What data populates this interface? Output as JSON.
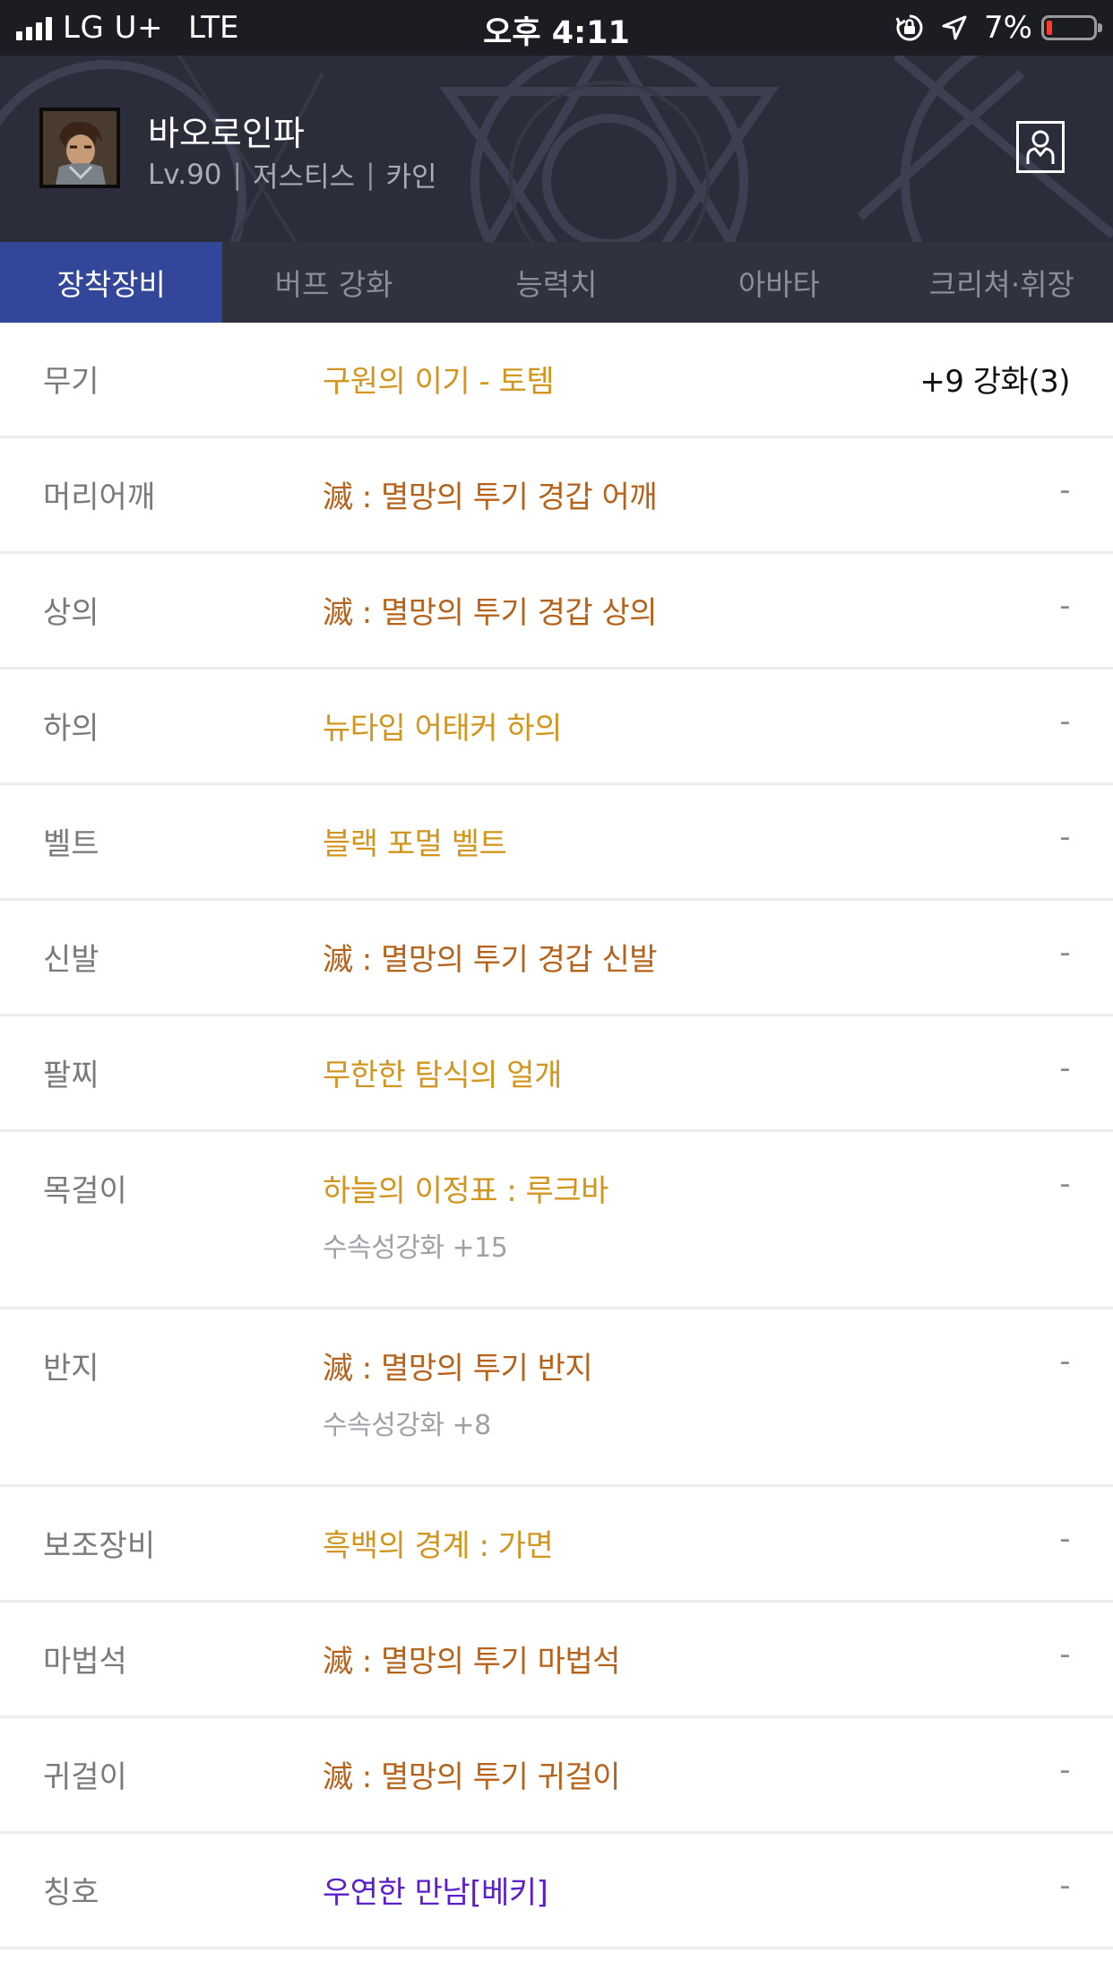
{
  "status_bar": {
    "carrier": "LG U+",
    "network": "LTE",
    "time": "오후 4:11",
    "battery_percent": "7%",
    "battery_level": 0.07,
    "battery_color": "#ff3b30"
  },
  "character": {
    "name": "바오로인파",
    "level": "Lv.90",
    "job": "저스티스",
    "server": "카인",
    "separator": "|",
    "avatar_icon": "character-portrait"
  },
  "tabs": [
    {
      "label": "장착장비",
      "active": true
    },
    {
      "label": "버프 강화",
      "active": false
    },
    {
      "label": "능력치",
      "active": false
    },
    {
      "label": "아바타",
      "active": false
    },
    {
      "label": "크리쳐·휘장",
      "active": false
    }
  ],
  "colors": {
    "active_tab": "#33479a",
    "unique": "#d2951e",
    "epic": "#b5621b",
    "rare": "#5b1ec8"
  },
  "equipment": [
    {
      "slot": "무기",
      "item": "구원의 이기 - 토템",
      "grade": "unique",
      "enhance": "+9 강화(3)"
    },
    {
      "slot": "머리어깨",
      "item": "滅 : 멸망의 투기 경갑 어깨",
      "grade": "epic",
      "enhance": "-"
    },
    {
      "slot": "상의",
      "item": "滅 : 멸망의 투기 경갑 상의",
      "grade": "epic",
      "enhance": "-"
    },
    {
      "slot": "하의",
      "item": "뉴타입 어태커 하의",
      "grade": "unique",
      "enhance": "-"
    },
    {
      "slot": "벨트",
      "item": "블랙 포멀 벨트",
      "grade": "unique",
      "enhance": "-"
    },
    {
      "slot": "신발",
      "item": "滅 : 멸망의 투기 경갑 신발",
      "grade": "epic",
      "enhance": "-"
    },
    {
      "slot": "팔찌",
      "item": "무한한 탐식의 얼개",
      "grade": "unique",
      "enhance": "-"
    },
    {
      "slot": "목걸이",
      "item": "하늘의 이정표 : 루크바",
      "grade": "unique",
      "enhance": "-",
      "sub": "수속성강화 +15"
    },
    {
      "slot": "반지",
      "item": "滅 : 멸망의 투기 반지",
      "grade": "epic",
      "enhance": "-",
      "sub": "수속성강화 +8"
    },
    {
      "slot": "보조장비",
      "item": "흑백의 경계 : 가면",
      "grade": "unique",
      "enhance": "-"
    },
    {
      "slot": "마법석",
      "item": "滅 : 멸망의 투기 마법석",
      "grade": "epic",
      "enhance": "-"
    },
    {
      "slot": "귀걸이",
      "item": "滅 : 멸망의 투기 귀걸이",
      "grade": "epic",
      "enhance": "-"
    },
    {
      "slot": "칭호",
      "item": "우연한 만남[베키]",
      "grade": "rare",
      "enhance": "-"
    }
  ]
}
